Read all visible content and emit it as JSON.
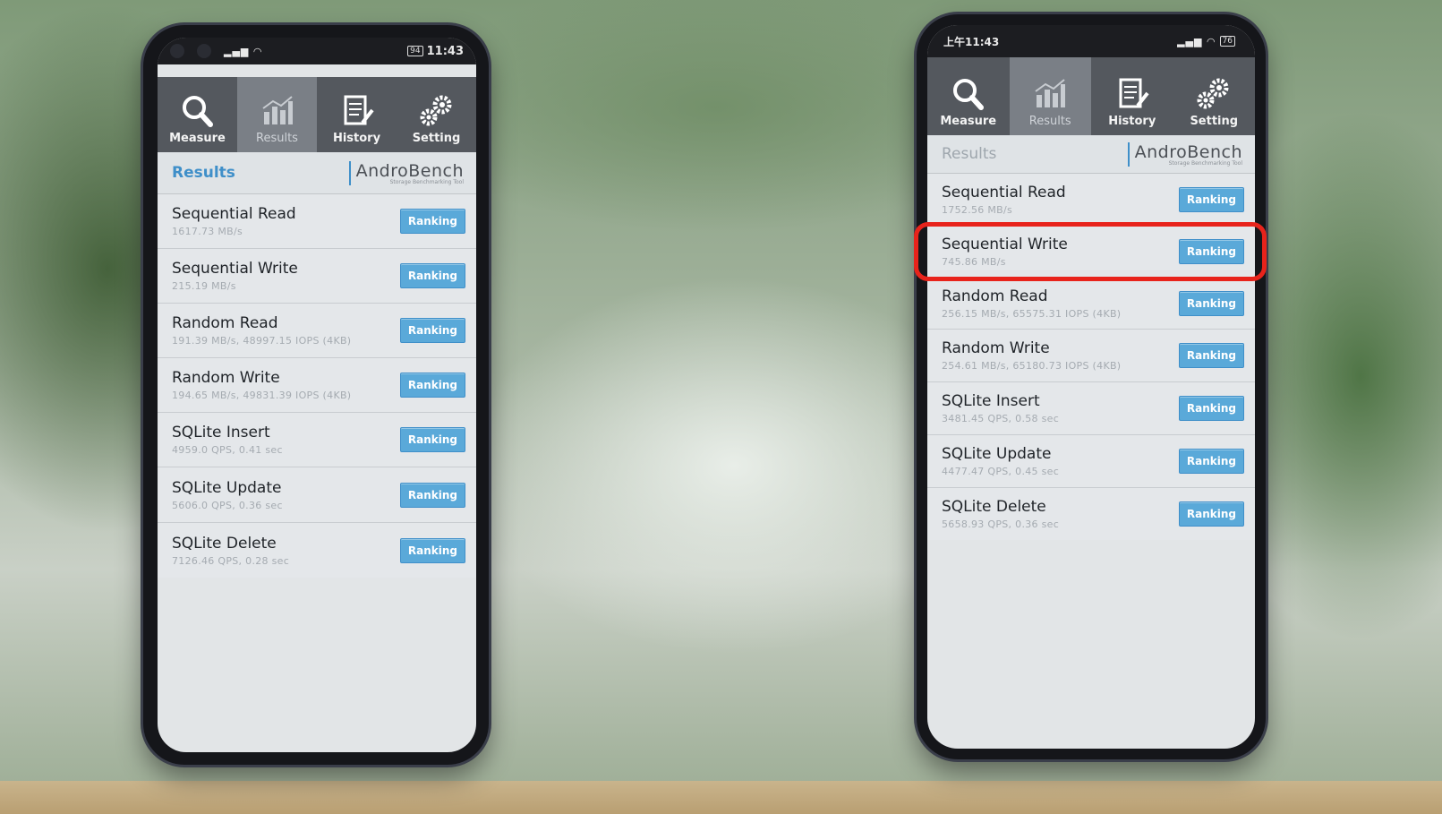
{
  "left_phone": {
    "status": {
      "time": "11:43",
      "battery": "94"
    },
    "tabs": [
      {
        "label": "Measure",
        "icon": "search-icon",
        "active": false
      },
      {
        "label": "Results",
        "icon": "chart-icon",
        "active": true
      },
      {
        "label": "History",
        "icon": "document-icon",
        "active": false
      },
      {
        "label": "Setting",
        "icon": "gear-icon",
        "active": false
      }
    ],
    "header": {
      "title": "Results",
      "logo": "AndroBench",
      "logo_sub": "Storage Benchmarking Tool"
    },
    "results": [
      {
        "title": "Sequential Read",
        "value": "1617.73 MB/s",
        "button": "Ranking"
      },
      {
        "title": "Sequential Write",
        "value": "215.19 MB/s",
        "button": "Ranking"
      },
      {
        "title": "Random Read",
        "value": "191.39 MB/s, 48997.15 IOPS (4KB)",
        "button": "Ranking"
      },
      {
        "title": "Random Write",
        "value": "194.65 MB/s, 49831.39 IOPS (4KB)",
        "button": "Ranking"
      },
      {
        "title": "SQLite Insert",
        "value": "4959.0 QPS, 0.41 sec",
        "button": "Ranking"
      },
      {
        "title": "SQLite Update",
        "value": "5606.0 QPS, 0.36 sec",
        "button": "Ranking"
      },
      {
        "title": "SQLite Delete",
        "value": "7126.46 QPS, 0.28 sec",
        "button": "Ranking"
      }
    ]
  },
  "right_phone": {
    "status": {
      "time": "上午11:43",
      "battery": "76"
    },
    "tabs": [
      {
        "label": "Measure",
        "icon": "search-icon",
        "active": false
      },
      {
        "label": "Results",
        "icon": "chart-icon",
        "active": true
      },
      {
        "label": "History",
        "icon": "document-icon",
        "active": false
      },
      {
        "label": "Setting",
        "icon": "gear-icon",
        "active": false
      }
    ],
    "header": {
      "title": "Results",
      "logo": "AndroBench",
      "logo_sub": "Storage Benchmarking Tool"
    },
    "results": [
      {
        "title": "Sequential Read",
        "value": "1752.56 MB/s",
        "button": "Ranking"
      },
      {
        "title": "Sequential Write",
        "value": "745.86 MB/s",
        "button": "Ranking"
      },
      {
        "title": "Random Read",
        "value": "256.15 MB/s, 65575.31 IOPS (4KB)",
        "button": "Ranking"
      },
      {
        "title": "Random Write",
        "value": "254.61 MB/s, 65180.73 IOPS (4KB)",
        "button": "Ranking"
      },
      {
        "title": "SQLite Insert",
        "value": "3481.45 QPS, 0.58 sec",
        "button": "Ranking"
      },
      {
        "title": "SQLite Update",
        "value": "4477.47 QPS, 0.45 sec",
        "button": "Ranking"
      },
      {
        "title": "SQLite Delete",
        "value": "5658.93 QPS, 0.36 sec",
        "button": "Ranking"
      }
    ],
    "highlighted_row": "Sequential Write",
    "highlight_color": "#e8231b"
  },
  "colors": {
    "accent": "#3f8fc9",
    "button": "#5aa9d9",
    "tab_bar": "#54585e"
  }
}
